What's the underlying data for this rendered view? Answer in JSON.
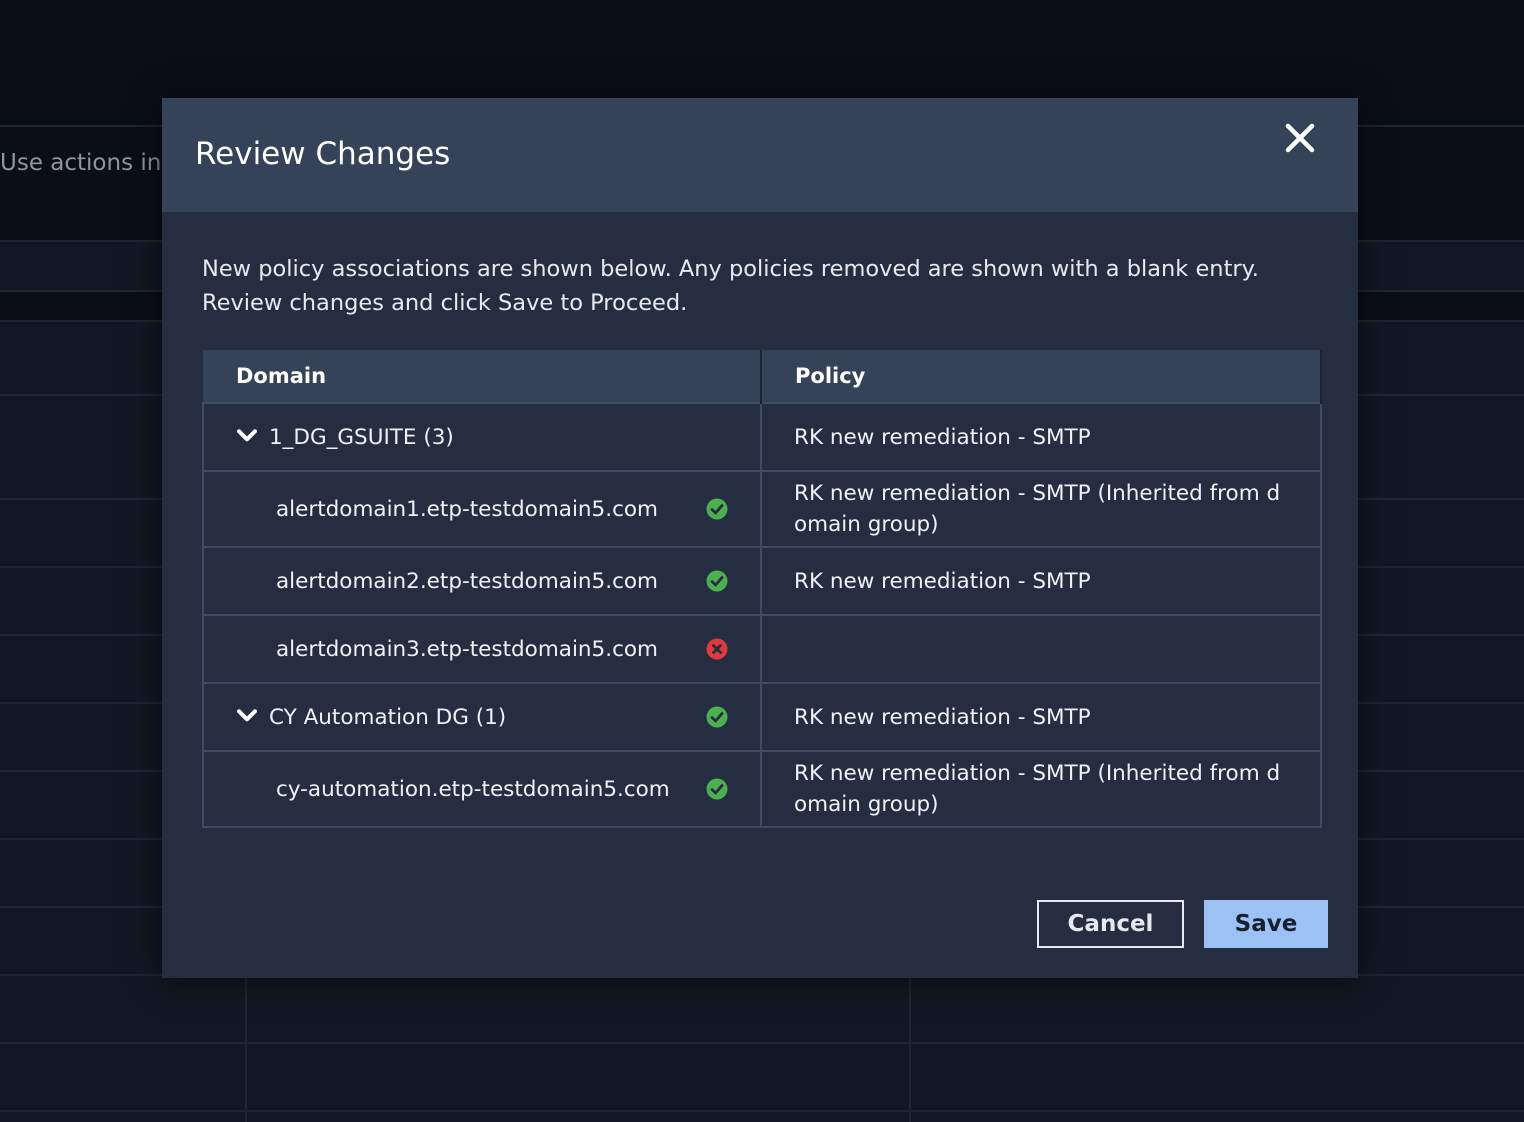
{
  "background": {
    "hint_text": "Use actions in"
  },
  "modal": {
    "title": "Review Changes",
    "intro_line1": "New policy associations are shown below. Any policies removed are shown with a blank entry.",
    "intro_line2": "Review changes and click Save to Proceed.",
    "table": {
      "headers": {
        "domain": "Domain",
        "policy": "Policy"
      },
      "rows": [
        {
          "type": "group",
          "domain": "1_DG_GSUITE (3)",
          "status": "none",
          "policy": "RK new remediation - SMTP"
        },
        {
          "type": "child",
          "domain": "alertdomain1.etp-testdomain5.com",
          "status": "ok",
          "policy": "RK new remediation - SMTP (Inherited from d omain group)"
        },
        {
          "type": "child",
          "domain": "alertdomain2.etp-testdomain5.com",
          "status": "ok",
          "policy": "RK new remediation - SMTP"
        },
        {
          "type": "child",
          "domain": "alertdomain3.etp-testdomain5.com",
          "status": "error",
          "policy": ""
        },
        {
          "type": "group",
          "domain": "CY Automation DG (1)",
          "status": "ok",
          "policy": "RK new remediation - SMTP"
        },
        {
          "type": "child",
          "domain": "cy-automation.etp-testdomain5.com",
          "status": "ok",
          "policy": "RK new remediation - SMTP (Inherited from d omain group)"
        }
      ]
    },
    "buttons": {
      "cancel": "Cancel",
      "save": "Save"
    }
  },
  "colors": {
    "ok": "#4caf50",
    "error": "#e0393e",
    "accent": "#9cc1f5"
  },
  "icons": {
    "close": "close-icon",
    "expand": "chevron-down-icon",
    "ok": "check-circle-icon",
    "error": "x-circle-icon"
  }
}
